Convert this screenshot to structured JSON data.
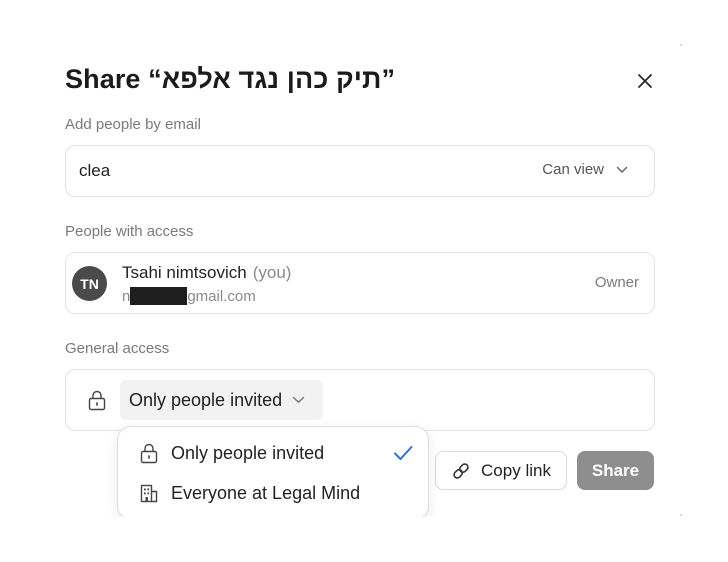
{
  "dialog": {
    "title": "Share “תיק כהן נגד אלפא”",
    "close_icon": "close-icon"
  },
  "add_people": {
    "label": "Add people by email",
    "input_value": "clea",
    "permission": "Can view",
    "permission_icon": "chevron-down-icon"
  },
  "people_with_access": {
    "label": "People with access",
    "people": [
      {
        "initials": "TN",
        "name": "Tsahi nimtsovich",
        "you_tag": "(you)",
        "email_prefix": "n",
        "email_suffix": "gmail.com",
        "role": "Owner"
      }
    ]
  },
  "general_access": {
    "label": "General access",
    "icon": "lock-icon",
    "selected": "Only people invited",
    "chevron": "chevron-down-icon"
  },
  "dropdown": {
    "options": [
      {
        "label": "Only people invited",
        "icon": "lock-icon",
        "selected": true
      },
      {
        "label": "Everyone at Legal Mind",
        "icon": "building-icon",
        "selected": false
      }
    ],
    "check_icon": "check-icon"
  },
  "actions": {
    "copy_link_label": "Copy link",
    "copy_link_icon": "link-icon",
    "share_label": "Share"
  },
  "colors": {
    "share_button_bg": "#8e8e8e",
    "avatar_bg": "#4a4a4a",
    "check_color": "#2f6fd6",
    "select_bg": "#f2f2f2"
  }
}
